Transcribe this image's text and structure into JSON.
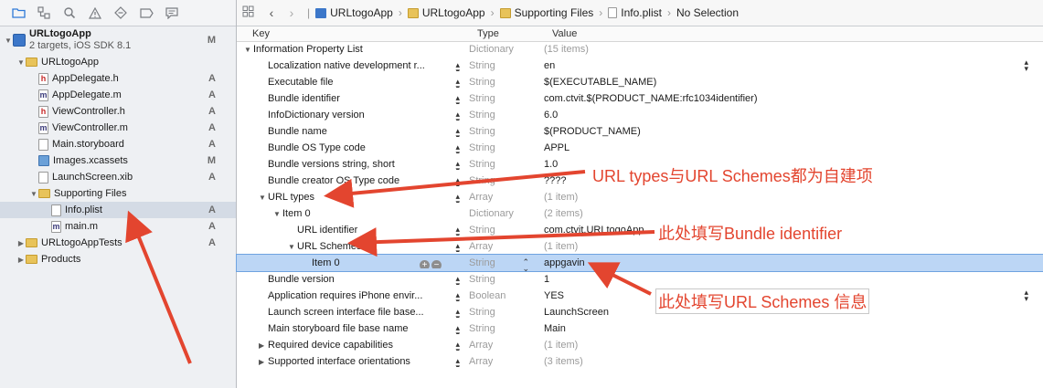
{
  "navigator": {
    "toolbar_icons": [
      "folder-icon",
      "hierarchy-icon",
      "search-icon",
      "warning-icon",
      "test-diamond-icon",
      "breakpoint-icon",
      "log-icon"
    ],
    "items": [
      {
        "label": "URLtogoApp",
        "subtitle": "2 targets, iOS SDK 8.1",
        "badge": "M",
        "icon": "project",
        "level": 0,
        "tri": "▼"
      },
      {
        "label": "URLtogoApp",
        "badge": "",
        "icon": "folder",
        "level": 1,
        "tri": "▼"
      },
      {
        "label": "AppDelegate.h",
        "badge": "A",
        "icon": "h",
        "level": 2,
        "tri": ""
      },
      {
        "label": "AppDelegate.m",
        "badge": "A",
        "icon": "m",
        "level": 2,
        "tri": ""
      },
      {
        "label": "ViewController.h",
        "badge": "A",
        "icon": "h",
        "level": 2,
        "tri": ""
      },
      {
        "label": "ViewController.m",
        "badge": "A",
        "icon": "m",
        "level": 2,
        "tri": ""
      },
      {
        "label": "Main.storyboard",
        "badge": "A",
        "icon": "sb",
        "level": 2,
        "tri": ""
      },
      {
        "label": "Images.xcassets",
        "badge": "M",
        "icon": "xc",
        "level": 2,
        "tri": ""
      },
      {
        "label": "LaunchScreen.xib",
        "badge": "A",
        "icon": "sb",
        "level": 2,
        "tri": ""
      },
      {
        "label": "Supporting Files",
        "badge": "",
        "icon": "folder",
        "level": 2,
        "tri": "▼"
      },
      {
        "label": "Info.plist",
        "badge": "A",
        "icon": "pl",
        "level": 3,
        "tri": "",
        "selected": true
      },
      {
        "label": "main.m",
        "badge": "A",
        "icon": "m",
        "level": 3,
        "tri": ""
      },
      {
        "label": "URLtogoAppTests",
        "badge": "A",
        "icon": "folder",
        "level": 1,
        "tri": "▶"
      },
      {
        "label": "Products",
        "badge": "",
        "icon": "folder",
        "level": 1,
        "tri": "▶"
      }
    ]
  },
  "jumpbar": {
    "crumbs": [
      "URLtogoApp",
      "URLtogoApp",
      "Supporting Files",
      "Info.plist",
      "No Selection"
    ]
  },
  "columns": {
    "key": "Key",
    "type": "Type",
    "value": "Value"
  },
  "plist": [
    {
      "key": "Information Property List",
      "type": "Dictionary",
      "value": "(15 items)",
      "level": 0,
      "tri": "▼",
      "dim": true
    },
    {
      "key": "Localization native development r...",
      "type": "String",
      "value": "en",
      "level": 1,
      "step": true,
      "vstep": true
    },
    {
      "key": "Executable file",
      "type": "String",
      "value": "$(EXECUTABLE_NAME)",
      "level": 1,
      "step": true
    },
    {
      "key": "Bundle identifier",
      "type": "String",
      "value": "com.ctvit.$(PRODUCT_NAME:rfc1034identifier)",
      "level": 1,
      "step": true
    },
    {
      "key": "InfoDictionary version",
      "type": "String",
      "value": "6.0",
      "level": 1,
      "step": true
    },
    {
      "key": "Bundle name",
      "type": "String",
      "value": "$(PRODUCT_NAME)",
      "level": 1,
      "step": true
    },
    {
      "key": "Bundle OS Type code",
      "type": "String",
      "value": "APPL",
      "level": 1,
      "step": true
    },
    {
      "key": "Bundle versions string, short",
      "type": "String",
      "value": "1.0",
      "level": 1,
      "step": true
    },
    {
      "key": "Bundle creator OS Type code",
      "type": "String",
      "value": "????",
      "level": 1,
      "step": true
    },
    {
      "key": "URL types",
      "type": "Array",
      "value": "(1 item)",
      "level": 1,
      "tri": "▼",
      "dim": true,
      "step": true
    },
    {
      "key": "Item 0",
      "type": "Dictionary",
      "value": "(2 items)",
      "level": 2,
      "tri": "▼",
      "dim": true
    },
    {
      "key": "URL identifier",
      "type": "String",
      "value": "com.ctvit.URLtogoApp",
      "level": 3,
      "step": true
    },
    {
      "key": "URL Schemes",
      "type": "Array",
      "value": "(1 item)",
      "level": 3,
      "tri": "▼",
      "dim": true,
      "step": true
    },
    {
      "key": "Item 0",
      "type": "String",
      "value": "appgavin",
      "level": 4,
      "selected": true,
      "pm": true,
      "tstep": true
    },
    {
      "key": "Bundle version",
      "type": "String",
      "value": "1",
      "level": 1,
      "step": true
    },
    {
      "key": "Application requires iPhone envir...",
      "type": "Boolean",
      "value": "YES",
      "level": 1,
      "step": true,
      "vstep": true
    },
    {
      "key": "Launch screen interface file base...",
      "type": "String",
      "value": "LaunchScreen",
      "level": 1,
      "step": true
    },
    {
      "key": "Main storyboard file base name",
      "type": "String",
      "value": "Main",
      "level": 1,
      "step": true
    },
    {
      "key": "Required device capabilities",
      "type": "Array",
      "value": "(1 item)",
      "level": 1,
      "tri": "▶",
      "dim": true,
      "step": true
    },
    {
      "key": "Supported interface orientations",
      "type": "Array",
      "value": "(3 items)",
      "level": 1,
      "tri": "▶",
      "dim": true,
      "step": true
    }
  ],
  "annotations": {
    "url_types": "URL types与URL Schemes都为自建项",
    "bundle_id": "此处填写Bundle identifier",
    "url_schemes": "此处填写URL Schemes 信息"
  },
  "colors": {
    "annotation": "#e3452f",
    "selection": "#bcd6f5",
    "sidebar": "#eef0f3"
  }
}
